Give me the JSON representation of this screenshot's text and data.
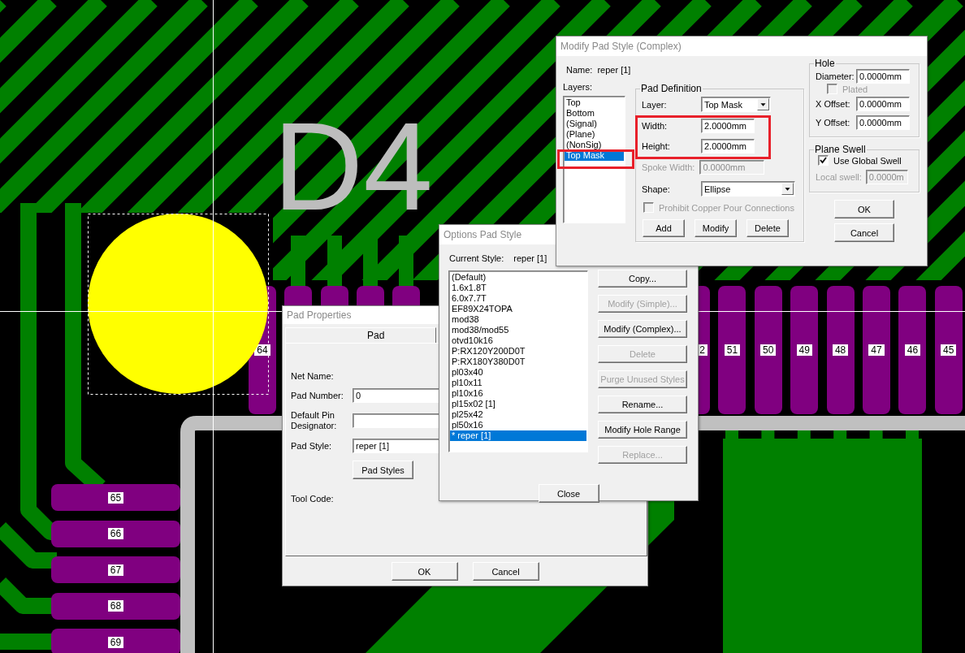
{
  "canvas": {
    "silkscreen": "D4",
    "top_pads": [
      {
        "label": "64"
      }
    ],
    "right_pads": [
      {
        "label": "2",
        "cut": true
      },
      {
        "label": "51",
        "cut": false
      },
      {
        "label": "50",
        "cut": false
      },
      {
        "label": "49",
        "cut": false
      },
      {
        "label": "48",
        "cut": false
      },
      {
        "label": "47",
        "cut": false
      },
      {
        "label": "46",
        "cut": false
      },
      {
        "label": "45",
        "cut": false
      }
    ],
    "left_pads": [
      {
        "label": "65"
      },
      {
        "label": "66"
      },
      {
        "label": "67"
      },
      {
        "label": "68"
      },
      {
        "label": "69"
      }
    ]
  },
  "pad_properties": {
    "title": "Pad Properties",
    "tabs": [
      {
        "label": "Pad",
        "selected": true
      }
    ],
    "rows": [
      {
        "kind": "label",
        "label": "Net Name:"
      },
      {
        "kind": "field",
        "label": "Pad Number:",
        "value": "0"
      },
      {
        "kind": "field",
        "label": "Default Pin Designator:"
      },
      {
        "kind": "field",
        "label": "Pad Style:",
        "value": "reper [1]"
      },
      {
        "kind": "button",
        "label": "Pad Styles"
      },
      {
        "kind": "label",
        "label": "Tool Code:"
      }
    ],
    "buttons": [
      "OK",
      "Cancel"
    ]
  },
  "options_pad_style": {
    "title": "Options Pad Style",
    "current_style_label": "Current Style:",
    "current_style": "reper [1]",
    "styles": [
      {
        "label": "(Default)",
        "selected": false
      },
      {
        "label": "1.6x1.8T",
        "selected": false
      },
      {
        "label": "6.0x7.7T",
        "selected": false
      },
      {
        "label": "EF89X24TOPA",
        "selected": false
      },
      {
        "label": "mod38",
        "selected": false
      },
      {
        "label": "mod38/mod55",
        "selected": false
      },
      {
        "label": "otvd10k16",
        "selected": false
      },
      {
        "label": "P:RX120Y200D0T",
        "selected": false
      },
      {
        "label": "P:RX180Y380D0T",
        "selected": false
      },
      {
        "label": "pl03x40",
        "selected": false
      },
      {
        "label": "pl10x11",
        "selected": false
      },
      {
        "label": "pl10x16",
        "selected": false
      },
      {
        "label": "pl15x02 [1]",
        "selected": false
      },
      {
        "label": "pl25x42",
        "selected": false
      },
      {
        "label": "pl50x16",
        "selected": false
      },
      {
        "label": "* reper [1]",
        "selected": true
      }
    ],
    "buttons": [
      {
        "label": "Copy...",
        "disabled": false
      },
      {
        "label": "Modify (Simple)...",
        "disabled": true
      },
      {
        "label": "Modify (Complex)...",
        "disabled": false
      },
      {
        "label": "Delete",
        "disabled": true
      },
      {
        "label": "Purge Unused Styles",
        "disabled": true
      },
      {
        "label": "Rename...",
        "disabled": false
      },
      {
        "label": "Modify Hole Range",
        "disabled": false
      },
      {
        "label": "Replace...",
        "disabled": true
      }
    ],
    "close": "Close"
  },
  "modify_pad_style": {
    "title": "Modify Pad Style (Complex)",
    "name_label": "Name:",
    "name": "reper [1]",
    "layers_label": "Layers:",
    "layers": [
      {
        "label": "Top",
        "selected": false
      },
      {
        "label": "Bottom",
        "selected": false
      },
      {
        "label": "(Signal)",
        "selected": false
      },
      {
        "label": "(Plane)",
        "selected": false
      },
      {
        "label": "(NonSig)",
        "selected": false
      },
      {
        "label": "Top Mask",
        "selected": true
      }
    ],
    "pad_definition": {
      "title": "Pad Definition",
      "layer_label": "Layer:",
      "layer": "Top Mask",
      "width_label": "Width:",
      "width": "2.0000mm",
      "height_label": "Height:",
      "height": "2.0000mm",
      "spoke_label": "Spoke Width:",
      "spoke": "0.0000mm",
      "spoke_disabled": true,
      "shape_label": "Shape:",
      "shape": "Ellipse",
      "prohibit": {
        "label": "Prohibit Copper Pour Connections",
        "checked": false,
        "disabled": true
      },
      "buttons": [
        "Add",
        "Modify",
        "Delete"
      ]
    },
    "hole": {
      "title": "Hole",
      "diameter_label": "Diameter:",
      "diameter": "0.0000mm",
      "plated": {
        "label": "Plated",
        "checked": false,
        "disabled": true
      },
      "x_offset_label": "X Offset:",
      "x_offset": "0.0000mm",
      "y_offset_label": "Y Offset:",
      "y_offset": "0.0000mm"
    },
    "plane_swell": {
      "title": "Plane Swell",
      "use_global": {
        "label": "Use Global Swell",
        "checked": true,
        "disabled": false
      },
      "local_label": "Local swell:",
      "local": "0.0000m",
      "local_disabled": true
    },
    "buttons": [
      "OK",
      "Cancel"
    ]
  }
}
